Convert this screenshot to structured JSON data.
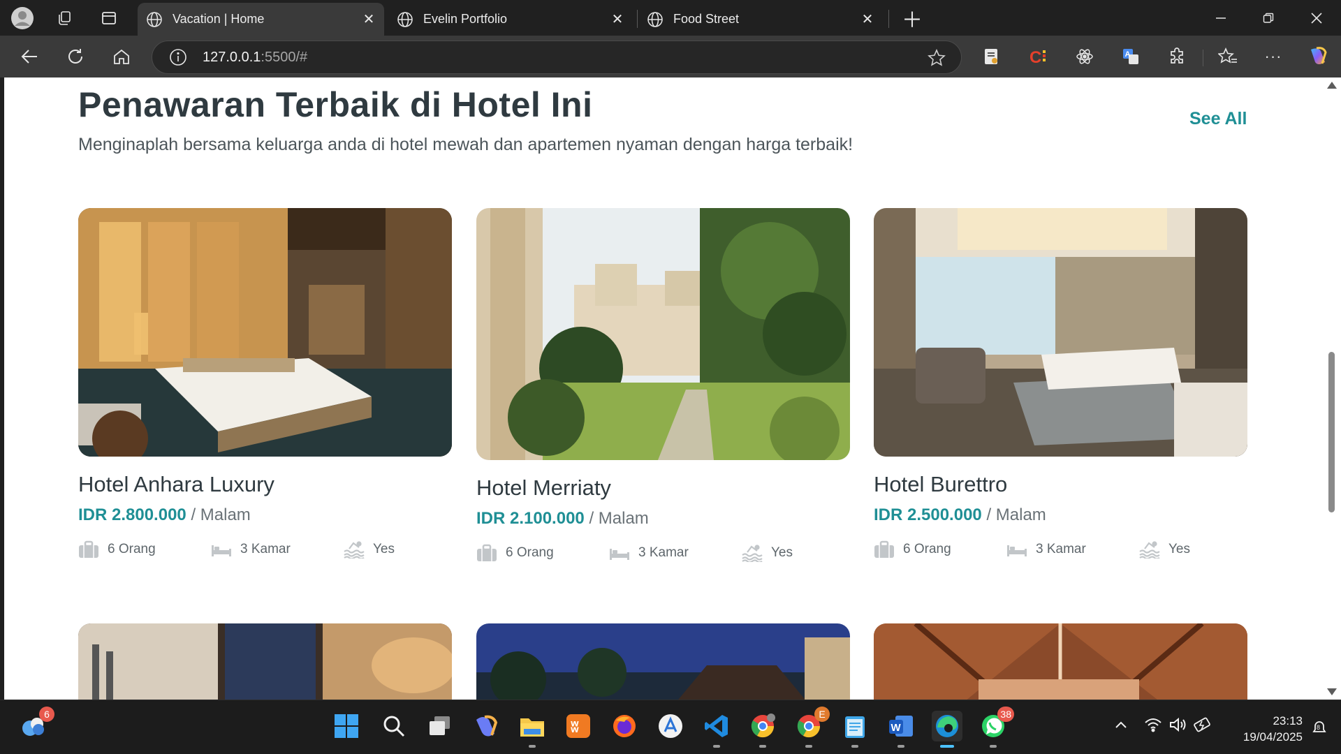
{
  "browser": {
    "tabs": [
      {
        "title": "Vacation | Home",
        "active": true
      },
      {
        "title": "Evelin Portfolio",
        "active": false
      },
      {
        "title": "Food Street",
        "active": false
      }
    ],
    "url_host": "127.0.0.1",
    "url_rest": ":5500/#",
    "icons": [
      "profile-icon",
      "workspaces-icon",
      "tab-actions-icon",
      "new-tab-icon",
      "minimize-icon",
      "restore-icon",
      "close-icon",
      "back-icon",
      "refresh-icon",
      "home-icon",
      "info-icon",
      "favorite-star-icon",
      "extensions-icon",
      "favorites-icon",
      "more-icon",
      "copilot-icon"
    ]
  },
  "section": {
    "title": "Penawaran Terbaik di Hotel Ini",
    "subtitle": "Menginaplah bersama keluarga anda di hotel mewah dan apartemen nyaman dengan harga terbaik!",
    "see_all": "See All"
  },
  "hotels": [
    {
      "name": "Hotel Anhara Luxury",
      "price": "IDR 2.800.000",
      "per": " / Malam",
      "guests": "6 Orang",
      "rooms": "3 Kamar",
      "pool": "Yes"
    },
    {
      "name": "Hotel Merriaty",
      "price": "IDR 2.100.000",
      "per": " / Malam",
      "guests": "6 Orang",
      "rooms": "3 Kamar",
      "pool": "Yes"
    },
    {
      "name": "Hotel Burettro",
      "price": "IDR 2.500.000",
      "per": " / Malam",
      "guests": "6 Orang",
      "rooms": "3 Kamar",
      "pool": "Yes"
    }
  ],
  "taskbar": {
    "widgets_badge": "6",
    "chrome_badge": "E",
    "whatsapp_badge": "38",
    "time": "23:13",
    "date": "19/04/2025",
    "notification_count": "8"
  },
  "colors": {
    "accent": "#1f8f95",
    "heading": "#2f3a40"
  }
}
